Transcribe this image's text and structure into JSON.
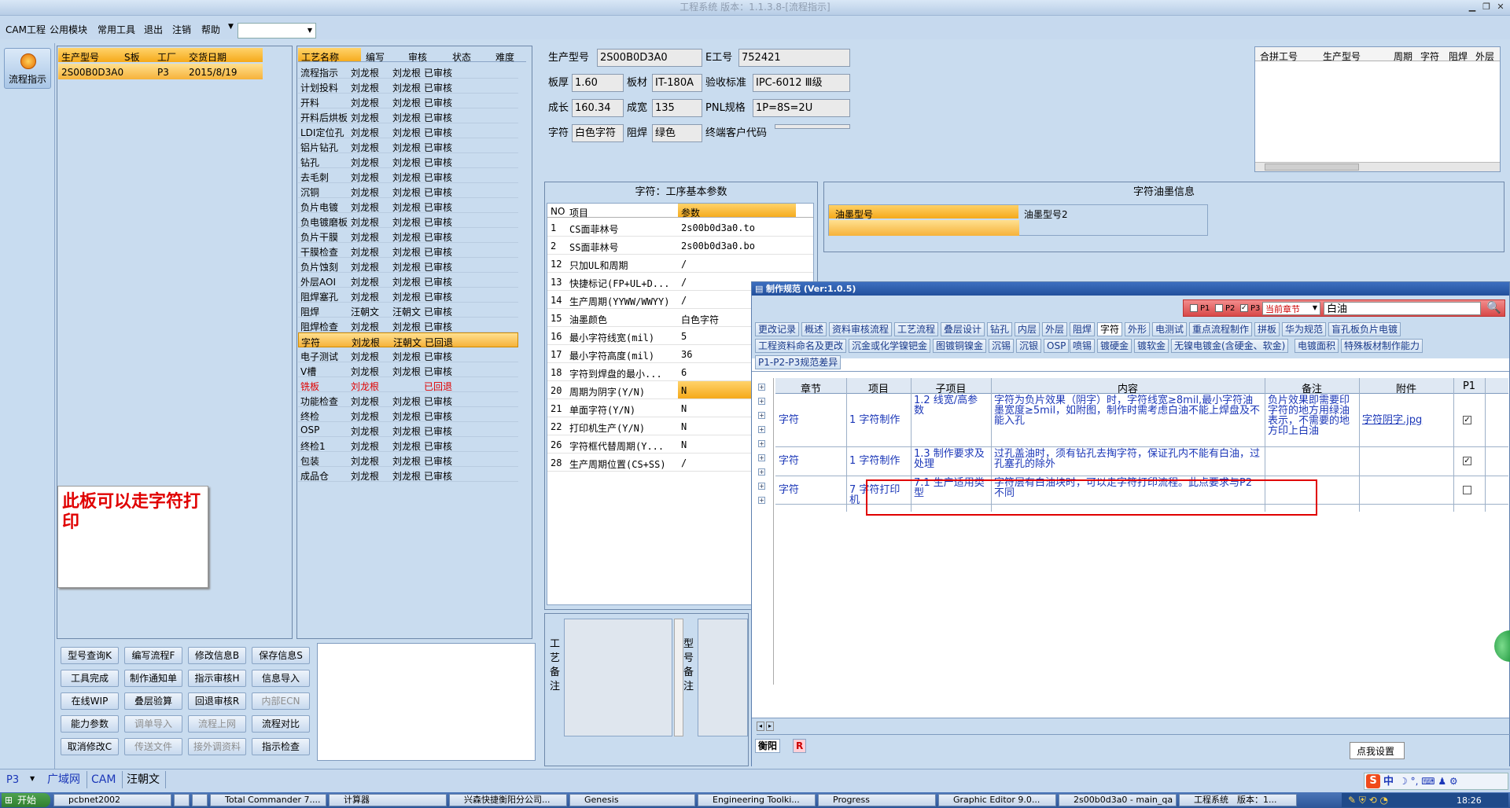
{
  "window": {
    "title": "工程系统 版本：1.1.3.8-[流程指示]"
  },
  "menu": {
    "items": [
      "CAM工程",
      "公用模块",
      "常用工具",
      "退出",
      "注销",
      "帮助"
    ]
  },
  "sidebar": {
    "button_label": "流程指示"
  },
  "prodlist": {
    "headers": [
      "生产型号",
      "S板",
      "工厂",
      "交货日期"
    ],
    "row": [
      "2S00B0D3A0",
      "",
      "P3",
      "2015/8/19"
    ]
  },
  "process": {
    "headers": [
      "工艺名称",
      "编写",
      "审核",
      "状态",
      "难度"
    ],
    "rows": [
      [
        "流程指示",
        "刘龙根",
        "刘龙根",
        "已审核"
      ],
      [
        "计划投料",
        "刘龙根",
        "刘龙根",
        "已审核"
      ],
      [
        "开料",
        "刘龙根",
        "刘龙根",
        "已审核"
      ],
      [
        "开料后烘板",
        "刘龙根",
        "刘龙根",
        "已审核"
      ],
      [
        "LDI定位孔",
        "刘龙根",
        "刘龙根",
        "已审核"
      ],
      [
        "铝片钻孔",
        "刘龙根",
        "刘龙根",
        "已审核"
      ],
      [
        "钻孔",
        "刘龙根",
        "刘龙根",
        "已审核"
      ],
      [
        "去毛刺",
        "刘龙根",
        "刘龙根",
        "已审核"
      ],
      [
        "沉铜",
        "刘龙根",
        "刘龙根",
        "已审核"
      ],
      [
        "负片电镀",
        "刘龙根",
        "刘龙根",
        "已审核"
      ],
      [
        "负电镀磨板",
        "刘龙根",
        "刘龙根",
        "已审核"
      ],
      [
        "负片干膜",
        "刘龙根",
        "刘龙根",
        "已审核"
      ],
      [
        "干膜检查",
        "刘龙根",
        "刘龙根",
        "已审核"
      ],
      [
        "负片蚀刻",
        "刘龙根",
        "刘龙根",
        "已审核"
      ],
      [
        "外层AOI",
        "刘龙根",
        "刘龙根",
        "已审核"
      ],
      [
        "阻焊塞孔",
        "刘龙根",
        "刘龙根",
        "已审核"
      ],
      [
        "阻焊",
        "汪朝文",
        "汪朝文",
        "已审核"
      ],
      [
        "阻焊检查",
        "刘龙根",
        "刘龙根",
        "已审核"
      ],
      [
        "字符",
        "刘龙根",
        "汪朝文",
        "已回退"
      ],
      [
        "电子测试",
        "刘龙根",
        "刘龙根",
        "已审核"
      ],
      [
        "V槽",
        "刘龙根",
        "刘龙根",
        "已审核"
      ],
      [
        "铣板",
        "刘龙根",
        "",
        "已回退"
      ],
      [
        "功能检查",
        "刘龙根",
        "刘龙根",
        "已审核"
      ],
      [
        "终检",
        "刘龙根",
        "刘龙根",
        "已审核"
      ],
      [
        "OSP",
        "刘龙根",
        "刘龙根",
        "已审核"
      ],
      [
        "终检1",
        "刘龙根",
        "刘龙根",
        "已审核"
      ],
      [
        "包装",
        "刘龙根",
        "刘龙根",
        "已审核"
      ],
      [
        "成品仓",
        "刘龙根",
        "刘龙根",
        "已审核"
      ]
    ]
  },
  "note": {
    "text": "此板可以走字符打印"
  },
  "buttons": [
    [
      "型号查询K",
      "编写流程F",
      "修改信息B",
      "保存信息S"
    ],
    [
      "工具完成",
      "制作通知单",
      "指示审核H",
      "信息导入"
    ],
    [
      "在线WIP",
      "叠层验算",
      "回退审核R",
      "内部ECN"
    ],
    [
      "能力参数",
      "调单导入",
      "流程上网",
      "流程对比"
    ],
    [
      "取消修改C",
      "传送文件",
      "接外调资料",
      "指示检查"
    ]
  ],
  "info": {
    "l_prod": "生产型号",
    "prod": "2S00B0D3A0",
    "l_e": "E工号",
    "e": "752421",
    "l_thick": "板厚",
    "thick": "1.60",
    "l_mat": "板材",
    "mat": "IT-180A",
    "l_std": "验收标准",
    "std": "IPC-6012 Ⅲ级",
    "l_len": "成长",
    "len": "160.34",
    "l_wid": "成宽",
    "wid": "135",
    "l_pnl": "PNL规格",
    "pnl": "1P=8S=2U",
    "l_char": "字符",
    "char": "白色字符",
    "l_mask": "阻焊",
    "mask": "绿色",
    "l_cust": "终端客户代码",
    "cust": ""
  },
  "merge": {
    "headers": [
      "合拼工号",
      "生产型号",
      "周期",
      "字符",
      "阻焊",
      "外层"
    ]
  },
  "params": {
    "title": "字符：工序基本参数",
    "headers": [
      "NO",
      "项目",
      "参数"
    ],
    "rows": [
      [
        "1",
        "CS面菲林号",
        "2s00b0d3a0.to"
      ],
      [
        "2",
        "SS面菲林号",
        "2s00b0d3a0.bo"
      ],
      [
        "12",
        "只加UL和周期",
        "/"
      ],
      [
        "13",
        "快捷标记(FP+UL+D...",
        "/"
      ],
      [
        "14",
        "生产周期(YYWW/WWYY)",
        "/"
      ],
      [
        "15",
        "油墨颜色",
        "白色字符"
      ],
      [
        "16",
        "最小字符线宽(mil)",
        "5"
      ],
      [
        "17",
        "最小字符高度(mil)",
        "36"
      ],
      [
        "18",
        "字符到焊盘的最小...",
        "6"
      ],
      [
        "20",
        "周期为阴字(Y/N)",
        "N"
      ],
      [
        "21",
        "单面字符(Y/N)",
        "N"
      ],
      [
        "22",
        "打印机生产(Y/N)",
        "N"
      ],
      [
        "26",
        "字符框代替周期(Y...",
        "N"
      ],
      [
        "28",
        "生产周期位置(CS+SS)",
        "/"
      ]
    ]
  },
  "ink": {
    "title": "字符油墨信息",
    "headers": [
      "油墨型号",
      "油墨型号2"
    ]
  },
  "remarks": {
    "left": "工艺备注",
    "right": "型号备注"
  },
  "spec": {
    "title": "制作规范 (Ver:1.0.5)",
    "chk": [
      "P1",
      "P2",
      "P3"
    ],
    "scope": "当前章节",
    "search": "白油",
    "tabs1": [
      "更改记录",
      "概述",
      "资料审核流程",
      "工艺流程",
      "叠层设计",
      "钻孔",
      "内层",
      "外层",
      "阻焊",
      "字符",
      "外形",
      "电测试",
      "重点流程制作",
      "拼板",
      "华为规范",
      "盲孔板负片电镀"
    ],
    "tabs2": [
      "工程资料命名及更改",
      "沉金或化学镍钯金",
      "图镀铜镍金",
      "沉锡",
      "沉银",
      "OSP",
      "喷锡",
      "镀硬金",
      "镀软金",
      "无镍电镀金(含硬金、软金)",
      "电镀面积",
      "特殊板材制作能力"
    ],
    "tabs3": [
      "P1-P2-P3规范差异"
    ],
    "headers": [
      "章节",
      "项目",
      "子项目",
      "内容",
      "备注",
      "附件",
      "P1"
    ],
    "rows": [
      [
        "字符",
        "1 字符制作",
        "1.2 线宽/高参数",
        "字符为负片效果（阴字）时，字符线宽≥8mil,最小字符油墨宽度≥5mil，如附图，制作时需考虑白油不能上焊盘及不能入孔",
        "负片效果即需要印字符的地方用绿油表示，不需要的地方印上白油",
        "字符阴字.jpg"
      ],
      [
        "字符",
        "1 字符制作",
        "1.3 制作要求及处理",
        "过孔盖油时，须有钻孔去掏字符，保证孔内不能有白油，过孔塞孔的除外",
        "",
        ""
      ],
      [
        "字符",
        "7 字符打印机",
        "7.1 生产适用类型",
        "字符层有白油块时，可以走字符打印流程。此点要求与P2不同",
        "",
        ""
      ]
    ],
    "tooltip": "点我设置",
    "bottom_tabs": [
      "衡阳",
      "R"
    ]
  },
  "status": {
    "factory": "P3",
    "items": [
      "广域网",
      "CAM",
      "汪朝文"
    ]
  },
  "taskbar": {
    "start": "开始",
    "items": [
      "pcbnet2002",
      "",
      "",
      "Total Commander 7....",
      "计算器",
      "兴森快捷衡阳分公司...",
      "Genesis",
      "Engineering Toolki...",
      "Progress",
      "Graphic Editor 9.0...",
      "2s00b0d3a0 - main_qa",
      "工程系统　版本：1..."
    ],
    "time": "18:26",
    "ime": "中"
  },
  "colors": {
    "accent": "#f5a91a",
    "bg": "#c9dcef",
    "red": "#e00000",
    "link": "#1b37b8"
  }
}
